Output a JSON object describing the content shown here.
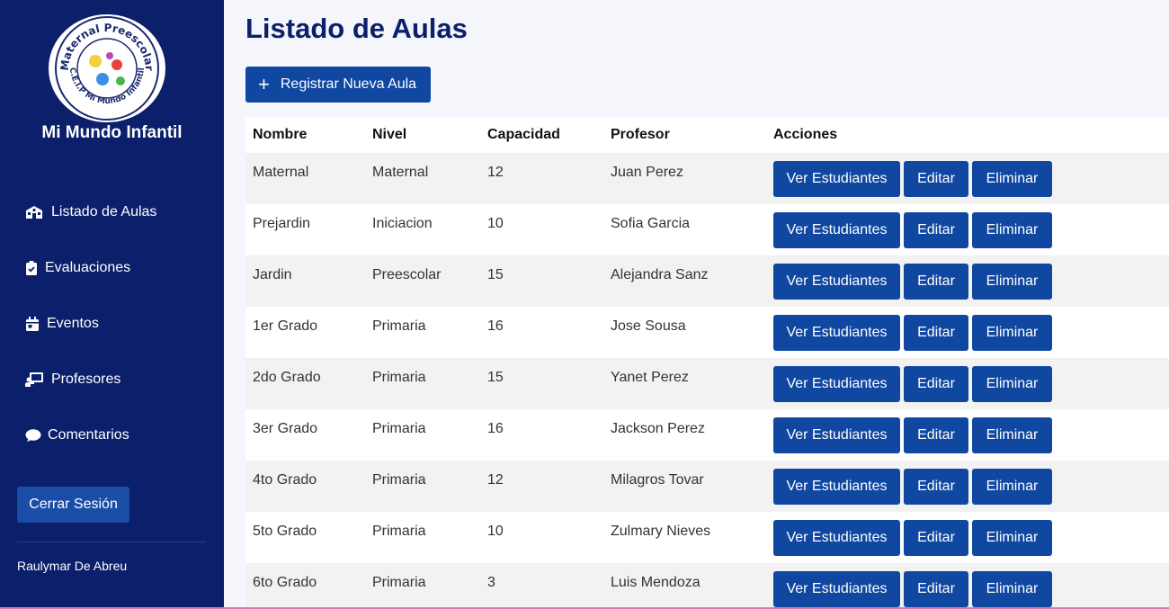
{
  "sidebar": {
    "logo_text_top": "Maternal Preescolar",
    "logo_text_bottom": "C.E.I.P Mi Mundo Infantil",
    "brand": "Mi Mundo Infantil",
    "items": [
      {
        "label": "Listado de Aulas",
        "icon": "school-icon"
      },
      {
        "label": "Evaluaciones",
        "icon": "clipboard-check-icon"
      },
      {
        "label": "Eventos",
        "icon": "calendar-icon"
      },
      {
        "label": "Profesores",
        "icon": "teacher-board-icon"
      },
      {
        "label": "Comentarios",
        "icon": "comment-icon"
      }
    ],
    "logout_label": "Cerrar Sesión",
    "user_name": "Raulymar De Abreu"
  },
  "main": {
    "title": "Listado de Aulas",
    "add_button_label": "Registrar Nueva Aula"
  },
  "table": {
    "headers": [
      "Nombre",
      "Nivel",
      "Capacidad",
      "Profesor",
      "Acciones"
    ],
    "rows": [
      {
        "nombre": "Maternal",
        "nivel": "Maternal",
        "capacidad": "12",
        "profesor": "Juan Perez"
      },
      {
        "nombre": "Prejardin",
        "nivel": "Iniciacion",
        "capacidad": "10",
        "profesor": "Sofia Garcia"
      },
      {
        "nombre": "Jardin",
        "nivel": "Preescolar",
        "capacidad": "15",
        "profesor": "Alejandra Sanz"
      },
      {
        "nombre": "1er Grado",
        "nivel": "Primaria",
        "capacidad": "16",
        "profesor": "Jose Sousa"
      },
      {
        "nombre": "2do Grado",
        "nivel": "Primaria",
        "capacidad": "15",
        "profesor": "Yanet Perez"
      },
      {
        "nombre": "3er Grado",
        "nivel": "Primaria",
        "capacidad": "16",
        "profesor": "Jackson Perez"
      },
      {
        "nombre": "4to Grado",
        "nivel": "Primaria",
        "capacidad": "12",
        "profesor": "Milagros Tovar"
      },
      {
        "nombre": "5to Grado",
        "nivel": "Primaria",
        "capacidad": "10",
        "profesor": "Zulmary Nieves"
      },
      {
        "nombre": "6to Grado",
        "nivel": "Primaria",
        "capacidad": "3",
        "profesor": "Luis Mendoza"
      }
    ],
    "actions": {
      "view": "Ver Estudiantes",
      "edit": "Editar",
      "delete": "Eliminar"
    }
  },
  "colors": {
    "sidebar_bg": "#0b1f6b",
    "primary_button": "#0f47a1",
    "title": "#0b1f6b"
  }
}
